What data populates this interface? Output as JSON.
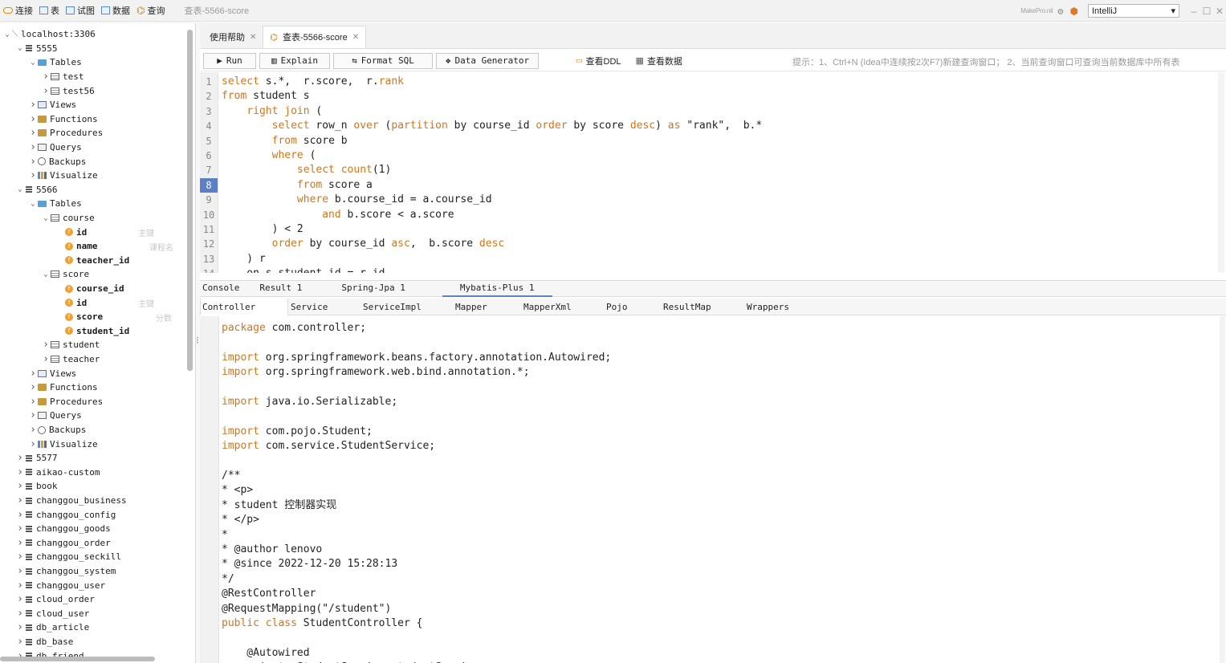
{
  "toolbar": {
    "connect": "连接",
    "table": "表",
    "view": "试图",
    "data": "数据",
    "query": "查询",
    "window_title": "查表-5566-score",
    "make": "MakePro.nil",
    "mode": "IntelliJ"
  },
  "tree": [
    {
      "depth": 0,
      "arrow": "v",
      "icon": "conn",
      "label": "localhost:3306"
    },
    {
      "depth": 1,
      "arrow": "v",
      "icon": "db",
      "label": "5555"
    },
    {
      "depth": 2,
      "arrow": "v",
      "icon": "fold",
      "label": "Tables"
    },
    {
      "depth": 3,
      "arrow": ">",
      "icon": "tbl",
      "label": "test"
    },
    {
      "depth": 3,
      "arrow": ">",
      "icon": "tbl",
      "label": "test56"
    },
    {
      "depth": 2,
      "arrow": ">",
      "icon": "view",
      "label": "Views"
    },
    {
      "depth": 2,
      "arrow": ">",
      "icon": "fn",
      "label": "Functions"
    },
    {
      "depth": 2,
      "arrow": ">",
      "icon": "fn",
      "label": "Procedures"
    },
    {
      "depth": 2,
      "arrow": ">",
      "icon": "que",
      "label": "Querys"
    },
    {
      "depth": 2,
      "arrow": ">",
      "icon": "bak",
      "label": "Backups"
    },
    {
      "depth": 2,
      "arrow": ">",
      "icon": "vis",
      "label": "Visualize"
    },
    {
      "depth": 1,
      "arrow": "v",
      "icon": "db",
      "label": "5566"
    },
    {
      "depth": 2,
      "arrow": "v",
      "icon": "fold",
      "label": "Tables"
    },
    {
      "depth": 3,
      "arrow": "v",
      "icon": "tbl",
      "label": "course"
    },
    {
      "depth": 4,
      "arrow": "",
      "icon": "col",
      "label": "id",
      "bold": true,
      "comment": "主键"
    },
    {
      "depth": 4,
      "arrow": "",
      "icon": "col",
      "label": "name",
      "bold": true,
      "comment": "课程名"
    },
    {
      "depth": 4,
      "arrow": "",
      "icon": "col",
      "label": "teacher_id",
      "bold": true,
      "comment": ""
    },
    {
      "depth": 3,
      "arrow": "v",
      "icon": "tbl",
      "label": "score"
    },
    {
      "depth": 4,
      "arrow": "",
      "icon": "col",
      "label": "course_id",
      "bold": true,
      "comment": ""
    },
    {
      "depth": 4,
      "arrow": "",
      "icon": "col",
      "label": "id",
      "bold": true,
      "comment": "主键"
    },
    {
      "depth": 4,
      "arrow": "",
      "icon": "col",
      "label": "score",
      "bold": true,
      "comment": "分数"
    },
    {
      "depth": 4,
      "arrow": "",
      "icon": "col",
      "label": "student_id",
      "bold": true,
      "comment": ""
    },
    {
      "depth": 3,
      "arrow": ">",
      "icon": "tbl",
      "label": "student"
    },
    {
      "depth": 3,
      "arrow": ">",
      "icon": "tbl",
      "label": "teacher"
    },
    {
      "depth": 2,
      "arrow": ">",
      "icon": "view",
      "label": "Views"
    },
    {
      "depth": 2,
      "arrow": ">",
      "icon": "fn",
      "label": "Functions"
    },
    {
      "depth": 2,
      "arrow": ">",
      "icon": "fn",
      "label": "Procedures"
    },
    {
      "depth": 2,
      "arrow": ">",
      "icon": "que",
      "label": "Querys"
    },
    {
      "depth": 2,
      "arrow": ">",
      "icon": "bak",
      "label": "Backups"
    },
    {
      "depth": 2,
      "arrow": ">",
      "icon": "vis",
      "label": "Visualize"
    },
    {
      "depth": 1,
      "arrow": ">",
      "icon": "db",
      "label": "5577"
    },
    {
      "depth": 1,
      "arrow": ">",
      "icon": "db",
      "label": "aikao-custom"
    },
    {
      "depth": 1,
      "arrow": ">",
      "icon": "db",
      "label": "book"
    },
    {
      "depth": 1,
      "arrow": ">",
      "icon": "db",
      "label": "changgou_business"
    },
    {
      "depth": 1,
      "arrow": ">",
      "icon": "db",
      "label": "changgou_config"
    },
    {
      "depth": 1,
      "arrow": ">",
      "icon": "db",
      "label": "changgou_goods"
    },
    {
      "depth": 1,
      "arrow": ">",
      "icon": "db",
      "label": "changgou_order"
    },
    {
      "depth": 1,
      "arrow": ">",
      "icon": "db",
      "label": "changgou_seckill"
    },
    {
      "depth": 1,
      "arrow": ">",
      "icon": "db",
      "label": "changgou_system"
    },
    {
      "depth": 1,
      "arrow": ">",
      "icon": "db",
      "label": "changgou_user"
    },
    {
      "depth": 1,
      "arrow": ">",
      "icon": "db",
      "label": "cloud_order"
    },
    {
      "depth": 1,
      "arrow": ">",
      "icon": "db",
      "label": "cloud_user"
    },
    {
      "depth": 1,
      "arrow": ">",
      "icon": "db",
      "label": "db_article"
    },
    {
      "depth": 1,
      "arrow": ">",
      "icon": "db",
      "label": "db_base"
    },
    {
      "depth": 1,
      "arrow": ">",
      "icon": "db",
      "label": "db_friend"
    }
  ],
  "tabs": [
    {
      "label": "使用帮助",
      "active": false
    },
    {
      "label": "查表-5566-score",
      "active": true
    }
  ],
  "buttons": {
    "run": "Run",
    "explain": "Explain",
    "format": "Format SQL",
    "generator": "Data Generator",
    "ddl": "查看DDL",
    "data": "查看数据"
  },
  "hint": "提示：1、Ctrl+N (Idea中连续按2次F7)新建查询窗口； 2、当前查询窗口可查询当前数据库中所有表",
  "current_line": 8,
  "sql": [
    [
      [
        "kw",
        "select"
      ],
      [
        "t",
        " s.*,  r.score,  r."
      ],
      [
        "kw",
        "rank"
      ]
    ],
    [
      [
        "kw",
        "from"
      ],
      [
        "t",
        " student s"
      ]
    ],
    [
      [
        "t",
        "    "
      ],
      [
        "kw",
        "right join"
      ],
      [
        "t",
        " ("
      ]
    ],
    [
      [
        "t",
        "        "
      ],
      [
        "kw",
        "select"
      ],
      [
        "t",
        " row_n "
      ],
      [
        "kw",
        "over"
      ],
      [
        "t",
        " ("
      ],
      [
        "kw",
        "partition"
      ],
      [
        "t",
        " by course_id "
      ],
      [
        "kw",
        "order"
      ],
      [
        "t",
        " by score "
      ],
      [
        "kw",
        "desc"
      ],
      [
        "t",
        ") "
      ],
      [
        "kw",
        "as"
      ],
      [
        "t",
        " \"rank\",  b.*"
      ]
    ],
    [
      [
        "t",
        "        "
      ],
      [
        "kw",
        "from"
      ],
      [
        "t",
        " score b"
      ]
    ],
    [
      [
        "t",
        "        "
      ],
      [
        "kw",
        "where"
      ],
      [
        "t",
        " ("
      ]
    ],
    [
      [
        "t",
        "            "
      ],
      [
        "kw",
        "select"
      ],
      [
        "t",
        " "
      ],
      [
        "kw",
        "count"
      ],
      [
        "t",
        "(1)"
      ]
    ],
    [
      [
        "t",
        "            "
      ],
      [
        "kw",
        "from"
      ],
      [
        "t",
        " score a"
      ]
    ],
    [
      [
        "t",
        "            "
      ],
      [
        "kw",
        "where"
      ],
      [
        "t",
        " b.course_id = a.course_id"
      ]
    ],
    [
      [
        "t",
        "                "
      ],
      [
        "kw",
        "and"
      ],
      [
        "t",
        " b.score < a.score"
      ]
    ],
    [
      [
        "t",
        "        ) < 2"
      ]
    ],
    [
      [
        "t",
        "        "
      ],
      [
        "kw",
        "order"
      ],
      [
        "t",
        " by course_id "
      ],
      [
        "kw",
        "asc"
      ],
      [
        "t",
        ",  b.score "
      ],
      [
        "kw",
        "desc"
      ]
    ],
    [
      [
        "t",
        "    ) r"
      ]
    ],
    [
      [
        "t",
        "    on s.student_id = r.id"
      ]
    ]
  ],
  "result_tabs": [
    {
      "label": "Console",
      "active": false
    },
    {
      "label": "Result 1",
      "active": false
    },
    {
      "label": "Spring-Jpa 1",
      "active": false
    },
    {
      "label": "Mybatis-Plus 1",
      "active": true
    }
  ],
  "sub_tabs": [
    {
      "label": "Controller",
      "active": true
    },
    {
      "label": "Service",
      "active": false
    },
    {
      "label": "ServiceImpl",
      "active": false
    },
    {
      "label": "Mapper",
      "active": false
    },
    {
      "label": "MapperXml",
      "active": false
    },
    {
      "label": "Pojo",
      "active": false
    },
    {
      "label": "ResultMap",
      "active": false
    },
    {
      "label": "Wrappers",
      "active": false
    }
  ],
  "java": [
    [
      [
        "kw",
        "package"
      ],
      [
        "t",
        " com.controller;"
      ]
    ],
    [
      [
        "t",
        ""
      ]
    ],
    [
      [
        "kw",
        "import"
      ],
      [
        "t",
        " org.springframework.beans.factory.annotation.Autowired;"
      ]
    ],
    [
      [
        "kw",
        "import"
      ],
      [
        "t",
        " org.springframework.web.bind.annotation.*;"
      ]
    ],
    [
      [
        "t",
        ""
      ]
    ],
    [
      [
        "kw",
        "import"
      ],
      [
        "t",
        " java.io.Serializable;"
      ]
    ],
    [
      [
        "t",
        ""
      ]
    ],
    [
      [
        "kw",
        "import"
      ],
      [
        "t",
        " com.pojo.Student;"
      ]
    ],
    [
      [
        "kw",
        "import"
      ],
      [
        "t",
        " com.service.StudentService;"
      ]
    ],
    [
      [
        "t",
        ""
      ]
    ],
    [
      [
        "t",
        "/**"
      ]
    ],
    [
      [
        "t",
        "* <p>"
      ]
    ],
    [
      [
        "t",
        "* student 控制器实现"
      ]
    ],
    [
      [
        "t",
        "* </p>"
      ]
    ],
    [
      [
        "t",
        "*"
      ]
    ],
    [
      [
        "t",
        "* @author lenovo"
      ]
    ],
    [
      [
        "t",
        "* @since 2022-12-20 15:28:13"
      ]
    ],
    [
      [
        "t",
        "*/"
      ]
    ],
    [
      [
        "t",
        "@RestController"
      ]
    ],
    [
      [
        "t",
        "@RequestMapping(\"/student\")"
      ]
    ],
    [
      [
        "kw",
        "public class"
      ],
      [
        "t",
        " StudentController {"
      ]
    ],
    [
      [
        "t",
        ""
      ]
    ],
    [
      [
        "t",
        "    @Autowired"
      ]
    ],
    [
      [
        "t",
        "    private StudentService studentService;"
      ]
    ]
  ]
}
